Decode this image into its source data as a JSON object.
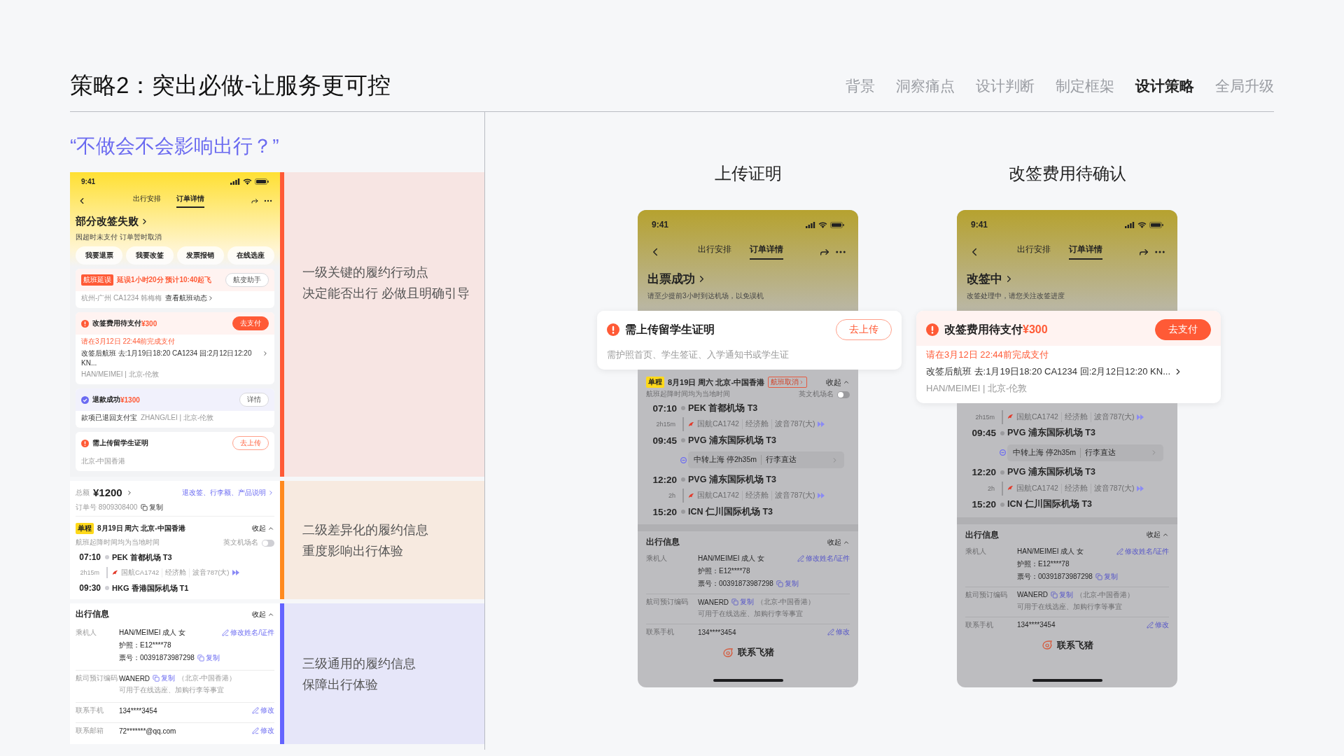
{
  "header": {
    "title": "策略2：突出必做-让服务更可控",
    "nav": [
      {
        "label": "背景",
        "selected": false
      },
      {
        "label": "洞察痛点",
        "selected": false
      },
      {
        "label": "设计判断",
        "selected": false
      },
      {
        "label": "制定框架",
        "selected": false
      },
      {
        "label": "设计策略",
        "selected": true
      },
      {
        "label": "全局升级",
        "selected": false
      }
    ]
  },
  "quote": "“不做会不会影响出行？”",
  "levels": [
    {
      "color": "#ff5a36",
      "lines": [
        "一级关键的履约行动点",
        "决定能否出行 必做且明确引导"
      ]
    },
    {
      "color": "#ff8a1f",
      "lines": [
        "二级差异化的履约信息",
        "重度影响出行体验"
      ]
    },
    {
      "color": "#6464ff",
      "lines": [
        "三级通用的履约信息",
        "保障出行体验"
      ]
    }
  ],
  "overview": {
    "status_bar": {
      "time": "9:41"
    },
    "tabs": [
      {
        "label": "出行安排",
        "selected": false
      },
      {
        "label": "订单详情",
        "selected": true
      }
    ],
    "title": "部分改签失败",
    "subtitle": "因超时未支付 订单暂时取消",
    "actions": [
      "我要退票",
      "我要改签",
      "发票报销",
      "在线选座"
    ],
    "cards": [
      {
        "kind": "delay",
        "tag": "航班延误",
        "title": "延误1小时20分 预计10:40起飞",
        "button": "航变助手",
        "route": "杭州-广州 CA1234 韩梅梅",
        "link": "查看航班动态"
      },
      {
        "kind": "pay",
        "title": "改签费用待支付",
        "amount": "¥300",
        "button": "去支付",
        "deadline": "请在3月12日 22:44前完成支付",
        "detail": "改签后航班 去:1月19日18:20 CA1234 回:2月12日12:20 KN...",
        "meta": "HAN/MEIMEI | 北京-伦敦"
      },
      {
        "kind": "refund",
        "title": "退款成功",
        "amount": "¥1300",
        "button": "详情",
        "detail": "款项已退回支付宝",
        "meta": "ZHANG/LEI | 北京-伦敦"
      },
      {
        "kind": "upload",
        "title": "需上传留学生证明",
        "button": "去上传",
        "meta": "北京-中国香港"
      }
    ],
    "summary": {
      "label": "总额",
      "amount": "¥1200",
      "link": "退改签、行李额、产品说明",
      "order": "订单号 8909308400",
      "copy": "复制"
    },
    "trip": {
      "tag": "单程",
      "title": "8月19日 周六 北京-中国香港",
      "toggle": "收起",
      "note": "航班起降时间均为当地时间",
      "switch_label": "英文机场名",
      "switch_on": false
    },
    "legs": [
      {
        "kind": "stop",
        "time": "07:10",
        "airport": "PEK 首都机场 T3"
      },
      {
        "kind": "flight",
        "duration": "2h15m",
        "airline": "国航CA1742",
        "cabin": "经济舱",
        "aircraft": "波音787(大)"
      },
      {
        "kind": "stop",
        "time": "09:30",
        "airport": "HKG 香港国际机场 T1"
      }
    ],
    "info": {
      "title": "出行信息",
      "toggle": "收起",
      "rows": [
        {
          "label": "乘机人",
          "lines": [
            {
              "text": "HAN/MEIMEI 成人 女",
              "action": {
                "kind": "edit",
                "label": "修改姓名/证件"
              }
            },
            {
              "text": "护照：E12****78"
            },
            {
              "text": "票号：00391873987298",
              "action": {
                "kind": "copy",
                "label": "复制"
              }
            }
          ]
        },
        {
          "label": "航司预订编码",
          "lines": [
            {
              "text": "WANERD",
              "action": {
                "kind": "copy",
                "label": "复制"
              },
              "note": "（北京-中国香港）"
            }
          ],
          "hint": "可用于在线选座、加购行李等事宜"
        },
        {
          "label": "联系手机",
          "lines": [
            {
              "text": "134****3454",
              "action": {
                "kind": "edit",
                "label": "修改"
              }
            }
          ]
        },
        {
          "label": "联系邮箱",
          "lines": [
            {
              "text": "72*******@qq.com",
              "action": {
                "kind": "edit",
                "label": "修改"
              }
            }
          ]
        }
      ]
    }
  },
  "phones": [
    {
      "caption": "上传证明",
      "status_bar": {
        "time": "9:41"
      },
      "tabs": [
        {
          "label": "出行安排",
          "selected": false
        },
        {
          "label": "订单详情",
          "selected": true
        }
      ],
      "title": "出票成功",
      "subtitle": "请至少提前3小时到达机场，以免误机",
      "card": {
        "kind": "upload",
        "title": "需上传留学生证明",
        "button": "去上传",
        "meta": "需护照首页、学生签证、入学通知书或学生证"
      },
      "trip": {
        "tag": "单程",
        "title": "8月19日 周六 北京-中国香港",
        "status": "航班取消",
        "toggle": "收起",
        "note": "航班起降时间均为当地时间",
        "switch_label": "英文机场名",
        "switch_on": false
      },
      "legs": [
        {
          "kind": "stop",
          "time": "07:10",
          "airport": "PEK 首都机场 T3"
        },
        {
          "kind": "flight",
          "duration": "2h15m",
          "airline": "国航CA1742",
          "cabin": "经济舱",
          "aircraft": "波音787(大)"
        },
        {
          "kind": "stop",
          "time": "09:45",
          "airport": "PVG 浦东国际机场 T3"
        },
        {
          "kind": "transfer",
          "text": "中转上海 停2h35m",
          "baggage": "行李直达"
        },
        {
          "kind": "stop",
          "time": "12:20",
          "airport": "PVG 浦东国际机场 T3"
        },
        {
          "kind": "flight",
          "duration": "2h",
          "airline": "国航CA1742",
          "cabin": "经济舱",
          "aircraft": "波音787(大)"
        },
        {
          "kind": "stop",
          "time": "15:20",
          "airport": "ICN 仁川国际机场 T3"
        }
      ],
      "info": {
        "title": "出行信息",
        "toggle": "收起",
        "rows": [
          {
            "label": "乘机人",
            "lines": [
              {
                "text": "HAN/MEIMEI 成人 女",
                "action": {
                  "kind": "edit",
                  "label": "修改姓名/证件"
                }
              },
              {
                "text": "护照：E12****78"
              },
              {
                "text": "票号：00391873987298",
                "action": {
                  "kind": "copy",
                  "label": "复制"
                }
              }
            ]
          },
          {
            "label": "航司预订编码",
            "lines": [
              {
                "text": "WANERD",
                "action": {
                  "kind": "copy",
                  "label": "复制"
                },
                "note": "（北京-中国香港）"
              }
            ],
            "hint": "可用于在线选座、加购行李等事宜"
          },
          {
            "label": "联系手机",
            "lines": [
              {
                "text": "134****3454",
                "action": {
                  "kind": "edit",
                  "label": "修改"
                }
              }
            ]
          }
        ]
      },
      "contact": "联系飞猪"
    },
    {
      "caption": "改签费用待确认",
      "status_bar": {
        "time": "9:41"
      },
      "tabs": [
        {
          "label": "出行安排",
          "selected": false
        },
        {
          "label": "订单详情",
          "selected": true
        }
      ],
      "title": "改签中",
      "subtitle": "改签处理中，请您关注改签进度",
      "card": {
        "kind": "pay",
        "title": "改签费用待支付",
        "amount": "¥300",
        "button": "去支付",
        "deadline": "请在3月12日 22:44前完成支付",
        "detail": "改签后航班 去:1月19日18:20 CA1234 回:2月12日12:20 KN...",
        "meta": "HAN/MEIMEI | 北京-伦敦"
      },
      "legs": [
        {
          "kind": "flight",
          "duration": "2h15m",
          "airline": "国航CA1742",
          "cabin": "经济舱",
          "aircraft": "波音787(大)"
        },
        {
          "kind": "stop",
          "time": "09:45",
          "airport": "PVG 浦东国际机场 T3"
        },
        {
          "kind": "transfer",
          "text": "中转上海 停2h35m",
          "baggage": "行李直达"
        },
        {
          "kind": "stop",
          "time": "12:20",
          "airport": "PVG 浦东国际机场 T3"
        },
        {
          "kind": "flight",
          "duration": "2h",
          "airline": "国航CA1742",
          "cabin": "经济舱",
          "aircraft": "波音787(大)"
        },
        {
          "kind": "stop",
          "time": "15:20",
          "airport": "ICN 仁川国际机场 T3"
        }
      ],
      "info": {
        "title": "出行信息",
        "toggle": "收起",
        "rows": [
          {
            "label": "乘机人",
            "lines": [
              {
                "text": "HAN/MEIMEI 成人 女",
                "action": {
                  "kind": "edit",
                  "label": "修改姓名/证件"
                }
              },
              {
                "text": "护照：E12****78"
              },
              {
                "text": "票号：00391873987298",
                "action": {
                  "kind": "copy",
                  "label": "复制"
                }
              }
            ]
          },
          {
            "label": "航司预订编码",
            "lines": [
              {
                "text": "WANERD",
                "action": {
                  "kind": "copy",
                  "label": "复制"
                },
                "note": "（北京-中国香港）"
              }
            ],
            "hint": "可用于在线选座、加购行李等事宜"
          },
          {
            "label": "联系手机",
            "lines": [
              {
                "text": "134****3454",
                "action": {
                  "kind": "edit",
                  "label": "修改"
                }
              }
            ]
          }
        ]
      },
      "contact": "联系飞猪"
    }
  ]
}
